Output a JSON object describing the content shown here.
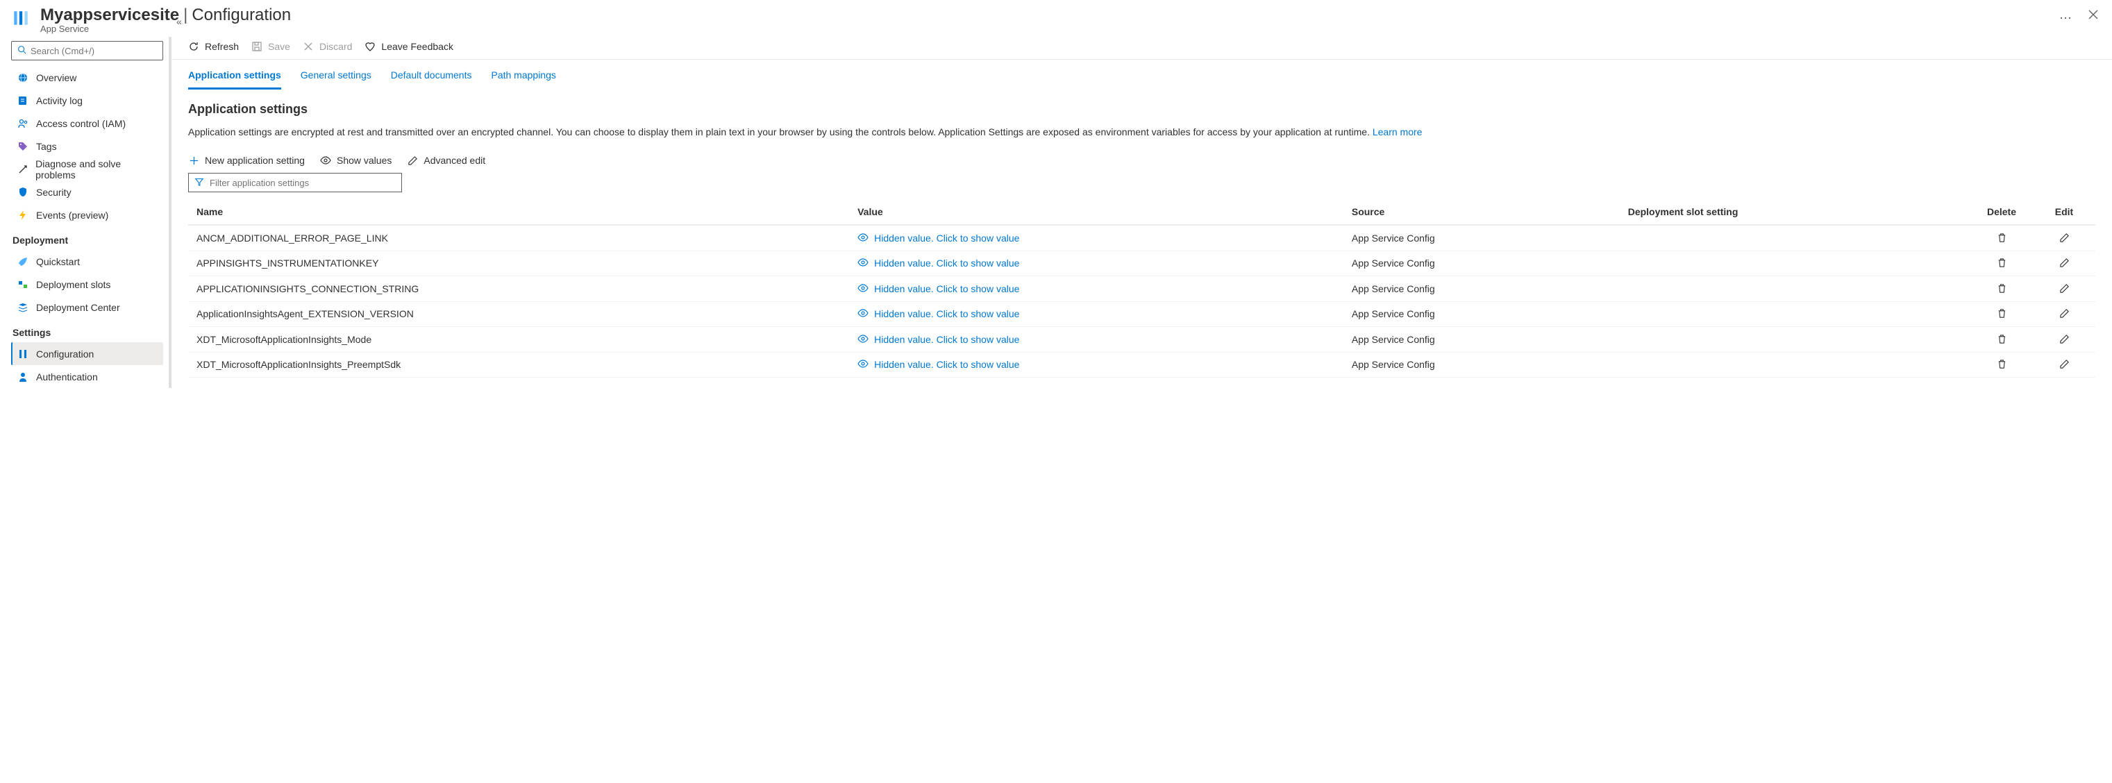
{
  "header": {
    "resource_name": "Myappservicesite",
    "page_title": "Configuration",
    "subtitle": "App Service"
  },
  "sidebar": {
    "search_placeholder": "Search (Cmd+/)",
    "items": [
      {
        "label": "Overview"
      },
      {
        "label": "Activity log"
      },
      {
        "label": "Access control (IAM)"
      },
      {
        "label": "Tags"
      },
      {
        "label": "Diagnose and solve problems"
      },
      {
        "label": "Security"
      },
      {
        "label": "Events (preview)"
      }
    ],
    "sections": {
      "deployment": {
        "title": "Deployment",
        "items": [
          {
            "label": "Quickstart"
          },
          {
            "label": "Deployment slots"
          },
          {
            "label": "Deployment Center"
          }
        ]
      },
      "settings": {
        "title": "Settings",
        "items": [
          {
            "label": "Configuration",
            "selected": true
          },
          {
            "label": "Authentication"
          }
        ]
      }
    }
  },
  "toolbar": {
    "refresh": "Refresh",
    "save": "Save",
    "discard": "Discard",
    "feedback": "Leave Feedback"
  },
  "tabs": [
    "Application settings",
    "General settings",
    "Default documents",
    "Path mappings"
  ],
  "section": {
    "heading": "Application settings",
    "body": "Application settings are encrypted at rest and transmitted over an encrypted channel. You can choose to display them in plain text in your browser by using the controls below. Application Settings are exposed as environment variables for access by your application at runtime. ",
    "learn_more": "Learn more"
  },
  "actions": {
    "new": "New application setting",
    "show_values": "Show values",
    "advanced_edit": "Advanced edit",
    "filter_placeholder": "Filter application settings"
  },
  "table": {
    "headers": {
      "name": "Name",
      "value": "Value",
      "source": "Source",
      "slot": "Deployment slot setting",
      "delete": "Delete",
      "edit": "Edit"
    },
    "hidden_value_text": "Hidden value. Click to show value",
    "rows": [
      {
        "name": "ANCM_ADDITIONAL_ERROR_PAGE_LINK",
        "source": "App Service Config"
      },
      {
        "name": "APPINSIGHTS_INSTRUMENTATIONKEY",
        "source": "App Service Config"
      },
      {
        "name": "APPLICATIONINSIGHTS_CONNECTION_STRING",
        "source": "App Service Config"
      },
      {
        "name": "ApplicationInsightsAgent_EXTENSION_VERSION",
        "source": "App Service Config"
      },
      {
        "name": "XDT_MicrosoftApplicationInsights_Mode",
        "source": "App Service Config"
      },
      {
        "name": "XDT_MicrosoftApplicationInsights_PreemptSdk",
        "source": "App Service Config"
      }
    ]
  }
}
